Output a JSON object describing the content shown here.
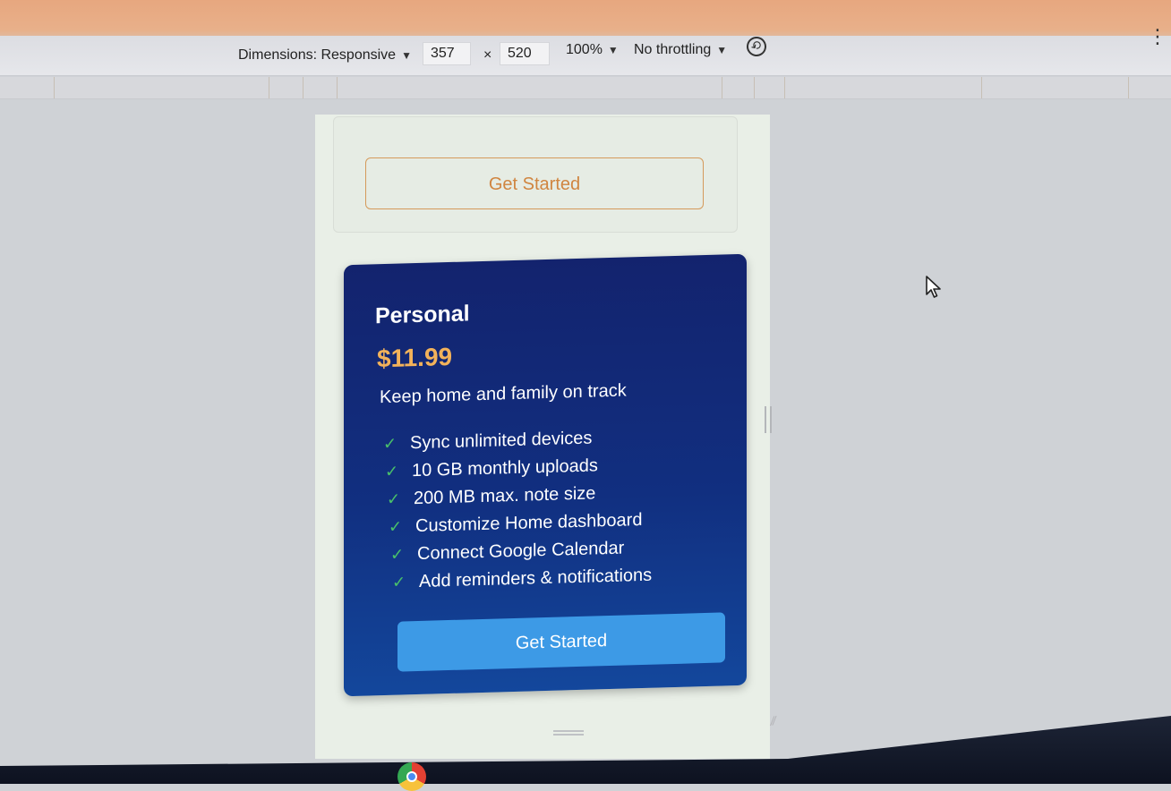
{
  "devtools_toolbar": {
    "dimensions_label": "Dimensions: Responsive",
    "width_value": "357",
    "times_sign": "×",
    "height_value": "520",
    "zoom_label": "100%",
    "throttling_label": "No throttling",
    "caret": "▼",
    "more_glyph": "⋮"
  },
  "upper_card": {
    "button_label": "Get Started",
    "accent_color": "#d08540"
  },
  "plan": {
    "title": "Personal",
    "price": "$11.99",
    "tagline": "Keep home and family on track",
    "features": [
      "Sync unlimited devices",
      "10 GB monthly uploads",
      "200 MB max. note size",
      "Customize Home dashboard",
      "Connect Google Calendar",
      "Add reminders & notifications"
    ],
    "check_glyph": "✓",
    "button_label": "Get Started",
    "colors": {
      "card_background": "#13236e",
      "price": "#f2b25a",
      "check": "#49c16a",
      "button": "#3d9ae6"
    }
  },
  "icons": [
    "rotate-icon",
    "kebab-icon",
    "mouse-cursor-icon",
    "check-icon",
    "chrome-icon"
  ]
}
